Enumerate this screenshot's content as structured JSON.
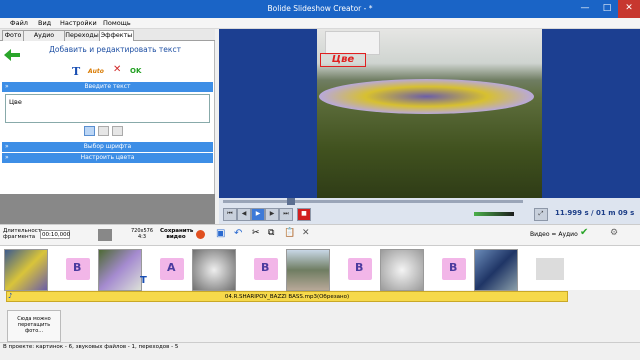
{
  "window": {
    "title": "Bolide Slideshow Creator - *",
    "min": "—",
    "max": "□",
    "close": "✕"
  },
  "menu": [
    "Файл",
    "Вид",
    "Настройки",
    "Помощь"
  ],
  "tabs": [
    "Фото",
    "Аудио файлы",
    "Переходы",
    "Эффекты"
  ],
  "effects": {
    "heading": "Добавить и редактировать текст",
    "auto": "Auto",
    "ok": "OK",
    "enter_text": "Введите текст",
    "text_value": "Цве",
    "font_section": "Выбор шрифта",
    "color_section": "Настроить цвета"
  },
  "preview": {
    "overlay_text": "Цве",
    "timer": "11.999 s  /  01 m 09 s"
  },
  "toolbar": {
    "duration_label": "Длительность фрагмента",
    "duration_value": "00:10,000",
    "resolution": "720x576 4:3",
    "save_video": "Сохранить видео",
    "video_audio": "Видео = Аудио"
  },
  "timeline": {
    "transitions": [
      "B",
      "A",
      "B",
      "B",
      "B"
    ],
    "audio_track": "04.R.SHARIPOV_BAZZI BASS.mp3(Обрезано)",
    "drop_zone": "Сюда можно перетащить фото..."
  },
  "status": "В проекте: картинок - 6, звуковых файлов - 1, переходов - 5",
  "colors": {
    "accent": "#3d8ee6",
    "preview_bg": "#1c3f91",
    "audio": "#f6d94b",
    "transition": "#f2b6e8"
  }
}
